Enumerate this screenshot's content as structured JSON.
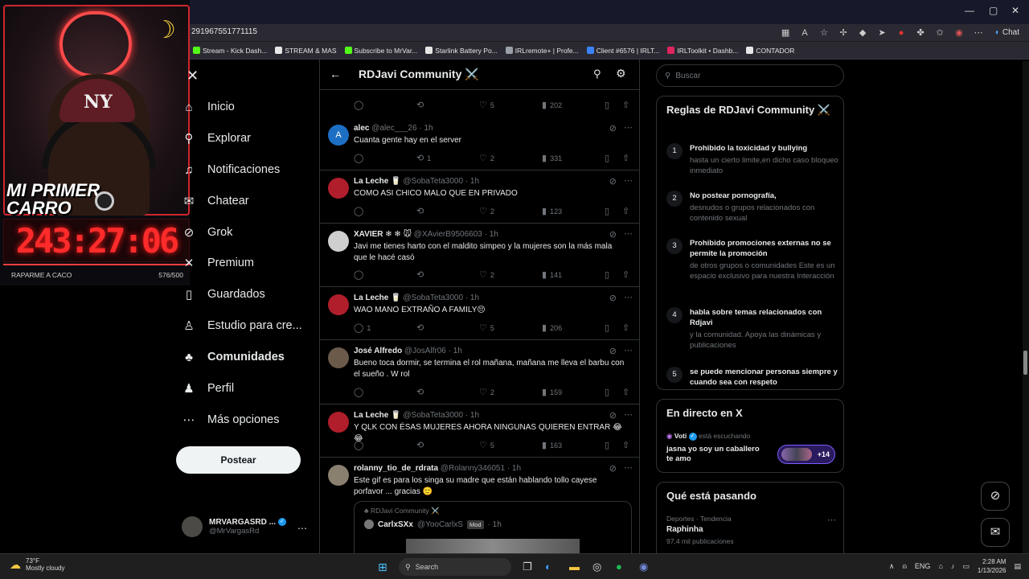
{
  "browser": {
    "url": "291967551771115",
    "chat_label": "Chat",
    "bookmarks": [
      {
        "label": "Stream - Kick Dash...",
        "color": "#53fc18"
      },
      {
        "label": "STREAM & MAS",
        "color": "#e7e7e7"
      },
      {
        "label": "Subscribe to MrVar...",
        "color": "#53fc18"
      },
      {
        "label": "Starlink Battery Po...",
        "color": "#e7e7e7"
      },
      {
        "label": "IRLremote+ | Profe...",
        "color": "#9aa0a6"
      },
      {
        "label": "Client #6576 | IRLT...",
        "color": "#3b82f6"
      },
      {
        "label": "IRLToolkit • Dashb...",
        "color": "#e0245e"
      },
      {
        "label": "CONTADOR",
        "color": "#e7e7e7"
      }
    ]
  },
  "overlay": {
    "car_text": "MI PRIMER CARRO",
    "timer": "243:27:06",
    "raparme": "RAPARME A CACO",
    "count": "576/500"
  },
  "nav": {
    "items": [
      {
        "label": "Inicio",
        "icon": "home-icon",
        "glyph": "⌂"
      },
      {
        "label": "Explorar",
        "icon": "search-icon",
        "glyph": "⚲"
      },
      {
        "label": "Notificaciones",
        "icon": "bell-icon",
        "glyph": "♫"
      },
      {
        "label": "Chatear",
        "icon": "chat-icon",
        "glyph": "✉"
      },
      {
        "label": "Grok",
        "icon": "grok-icon",
        "glyph": "⊘"
      },
      {
        "label": "Premium",
        "icon": "x-logo-icon",
        "glyph": "✕"
      },
      {
        "label": "Guardados",
        "icon": "bookmark-icon",
        "glyph": "▯"
      },
      {
        "label": "Estudio para cre...",
        "icon": "studio-icon",
        "glyph": "♙"
      },
      {
        "label": "Comunidades",
        "icon": "communities-icon",
        "glyph": "♣"
      },
      {
        "label": "Perfil",
        "icon": "profile-icon",
        "glyph": "♟"
      },
      {
        "label": "Más opciones",
        "icon": "more-options-icon",
        "glyph": "⋯"
      }
    ],
    "post_button": "Postear",
    "account": {
      "name": "MRVARGASRD ...",
      "handle": "@MrVargasRd"
    }
  },
  "feed": {
    "title": "RDJavi Community ⚔️",
    "top_actions": {
      "likes": "5",
      "views": "202"
    },
    "posts": [
      {
        "name": "alec",
        "handle": "@alec___26",
        "time": "· 1h",
        "text": "Cuanta gente hay en el server",
        "replies": "",
        "reposts": "1",
        "likes": "2",
        "views": "331",
        "avatar_color": "#1d6fc4",
        "avatar_letter": "A"
      },
      {
        "name": "La Leche 🥛",
        "handle": "@SobaTeta3000",
        "time": "· 1h",
        "text": "COMO ASI CHICO MALO QUE EN PRIVADO",
        "replies": "",
        "reposts": "",
        "likes": "2",
        "views": "123",
        "avatar_color": "#b01e2c",
        "avatar_letter": ""
      },
      {
        "name": "XAVIER ❄ ❄ 🐭",
        "handle": "@XAvierB9506603",
        "time": "· 1h",
        "text": "Javi me tienes harto con el  maldito simpeo y la mujeres son la más mala que le hacé casó",
        "replies": "",
        "reposts": "",
        "likes": "2",
        "views": "141",
        "avatar_color": "#cfcfcf",
        "avatar_letter": ""
      },
      {
        "name": "La Leche 🥛",
        "handle": "@SobaTeta3000",
        "time": "· 1h",
        "text": "WAO MANO EXTRAÑO A FAMILY😔",
        "replies": "1",
        "reposts": "",
        "likes": "5",
        "views": "206",
        "avatar_color": "#b01e2c",
        "avatar_letter": ""
      },
      {
        "name": "José Alfredo",
        "handle": "@JosAlfr06",
        "time": "· 1h",
        "text": "Bueno toca dormir, se termina el rol mañana, mañana me lleva el barbu con el sueño . W rol",
        "replies": "",
        "reposts": "",
        "likes": "2",
        "views": "159",
        "avatar_color": "#6b5a4a",
        "avatar_letter": ""
      },
      {
        "name": "La Leche 🥛",
        "handle": "@SobaTeta3000",
        "time": "· 1h",
        "text": "Y QLK CON ÉSAS MUJERES AHORA NINGUNAS QUIEREN ENTRAR 😂😂",
        "replies": "",
        "reposts": "",
        "likes": "5",
        "views": "163",
        "avatar_color": "#b01e2c",
        "avatar_letter": ""
      },
      {
        "name": "rolanny_tio_de_rdrata",
        "handle": "@Rolanny346051",
        "time": "· 1h",
        "text": "Este gif es para los singa su madre que  están hablando tollo cayese porfavor ... gracias 🙂",
        "replies": "",
        "reposts": "",
        "likes": "",
        "views": "",
        "avatar_color": "#8a8070",
        "avatar_letter": ""
      }
    ],
    "quote": {
      "community": "RDJavi Community ⚔️",
      "name": "CarlxSXx",
      "handle": "@YooCarlxS",
      "tag": "Mod",
      "time": "· 1h"
    }
  },
  "right": {
    "search_placeholder": "Buscar",
    "rules_title": "Reglas de RDJavi Community ⚔️",
    "rules": [
      {
        "n": "1",
        "title": "Prohibido la toxicidad y bullying",
        "desc": "hasta un cierto limite,en dicho caso bloqueo inmediato"
      },
      {
        "n": "2",
        "title": "No postear pornografía,",
        "desc": "desnudos o grupos relacionados con contenido sexual"
      },
      {
        "n": "3",
        "title": "Prohibido promociones externas no se permite la promoción",
        "desc": "de otros grupos o comunidades Este es un espacio exclusivo para nuestra Interacción"
      },
      {
        "n": "4",
        "title": "habla sobre temas relacionados con Rdjavi",
        "desc": "y la comunidad. Apoya las dinámicas y publicaciones"
      },
      {
        "n": "5",
        "title": "se puede mencionar personas siempre y cuando sea con respeto",
        "desc": ""
      }
    ],
    "live": {
      "title": "En directo en X",
      "host": "Voti",
      "status": "está escuchando",
      "text": "jasna yo soy un caballero te amo",
      "count": "+14"
    },
    "trending": {
      "title": "Qué está pasando",
      "category": "Deportes · Tendencia",
      "topic": "Raphinha",
      "posts": "97,4 mil publicaciones"
    }
  },
  "taskbar": {
    "temp": "73°F",
    "condition": "Mostly cloudy",
    "search": "Search",
    "lang": "ENG",
    "time": "2:28 AM",
    "date": "1/13/2026"
  }
}
